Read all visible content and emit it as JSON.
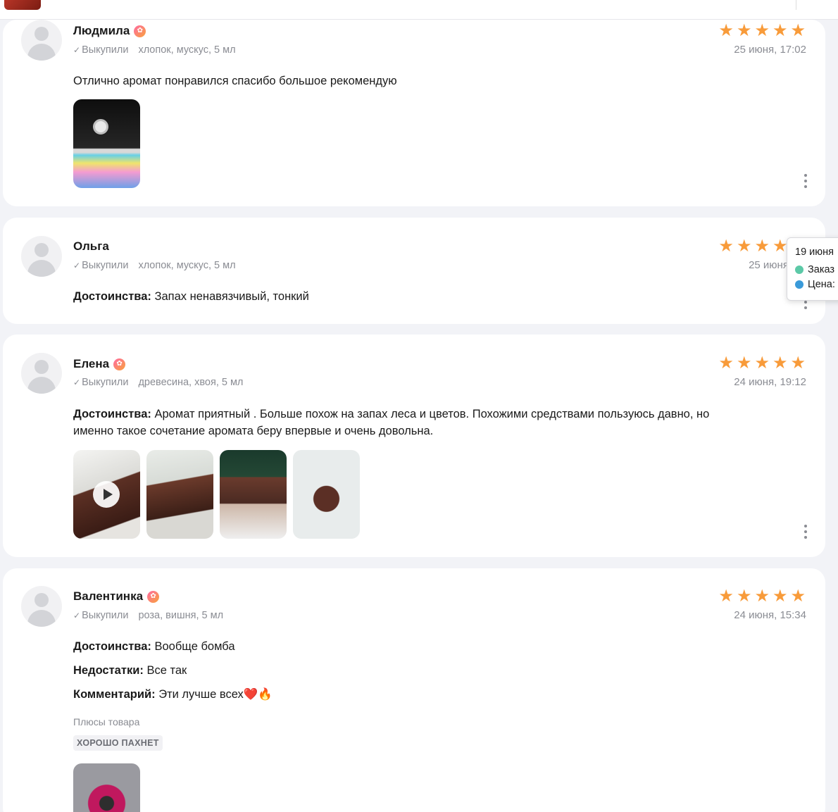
{
  "reviews": [
    {
      "name": "Людмила",
      "verified": "Выкупили",
      "variant": "хлопок, мускус, 5 мл",
      "date": "25 июня, 17:02",
      "rating": 5,
      "text": "Отлично аромат понравился спасибо большое рекомендую"
    },
    {
      "name": "Ольга",
      "verified": "Выкупили",
      "variant": "хлопок, мускус, 5 мл",
      "date": "25 июня, 08",
      "rating": 5,
      "pros_label": "Достоинства:",
      "pros": "Запах ненавязчивый, тонкий"
    },
    {
      "name": "Елена",
      "verified": "Выкупили",
      "variant": "древесина, хвоя, 5 мл",
      "date": "24 июня, 19:12",
      "rating": 5,
      "pros_label": "Достоинства:",
      "pros_line1": "Аромат приятный . Больше похож на запах леса и цветов. Похожими средствами пользуюсь давно, но",
      "pros_line2": "именно такое сочетание аромата беру впервые и очень довольна."
    },
    {
      "name": "Валентинка",
      "verified": "Выкупили",
      "variant": "роза, вишня, 5 мл",
      "date": "24 июня, 15:34",
      "rating": 5,
      "pros_label": "Достоинства:",
      "pros": "Вообще бомба",
      "cons_label": "Недостатки:",
      "cons": "Все так",
      "comment_label": "Комментарий:",
      "comment": "Эти лучше всех❤️🔥",
      "pluses_title": "Плюсы товара",
      "tag": "ХОРОШО ПАХНЕТ"
    }
  ],
  "tooltip": {
    "title": "19 июня",
    "row1": "Заказ",
    "row2": "Цена:",
    "row1_color": "#5cc9a7",
    "row2_color": "#3a9ad9"
  },
  "colors": {
    "star": "#f89b3a",
    "badge": "#ff6aa2"
  }
}
